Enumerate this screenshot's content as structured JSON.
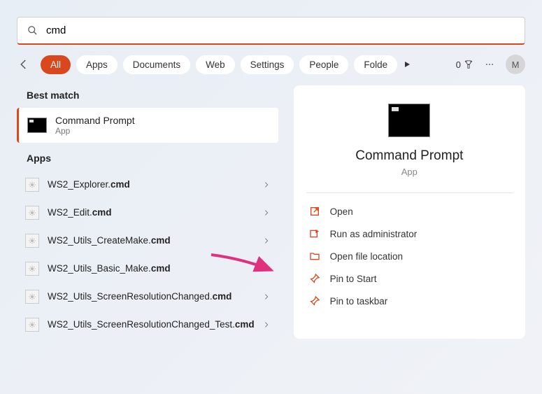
{
  "search": {
    "query": "cmd",
    "placeholder": ""
  },
  "tabs": {
    "items": [
      "All",
      "Apps",
      "Documents",
      "Web",
      "Settings",
      "People",
      "Folde"
    ],
    "active": 0
  },
  "rightControls": {
    "counter": "0",
    "avatarInitial": "M"
  },
  "sections": {
    "bestMatch": {
      "heading": "Best match",
      "title": "Command Prompt",
      "subtitle": "App"
    },
    "appsHeading": "Apps",
    "apps": [
      {
        "prefix": "WS2_Explorer.",
        "bold": "cmd"
      },
      {
        "prefix": "WS2_Edit.",
        "bold": "cmd"
      },
      {
        "prefix": "WS2_Utils_CreateMake.",
        "bold": "cmd"
      },
      {
        "prefix": "WS2_Utils_Basic_Make.",
        "bold": "cmd"
      },
      {
        "prefix": "WS2_Utils_ScreenResolutionChanged.",
        "bold": "cmd"
      },
      {
        "prefix": "WS2_Utils_ScreenResolutionChanged_Test.",
        "bold": "cmd"
      }
    ]
  },
  "preview": {
    "title": "Command Prompt",
    "subtitle": "App",
    "actions": [
      {
        "label": "Open",
        "icon": "open"
      },
      {
        "label": "Run as administrator",
        "icon": "admin"
      },
      {
        "label": "Open file location",
        "icon": "folder"
      },
      {
        "label": "Pin to Start",
        "icon": "pin"
      },
      {
        "label": "Pin to taskbar",
        "icon": "pin"
      }
    ]
  }
}
